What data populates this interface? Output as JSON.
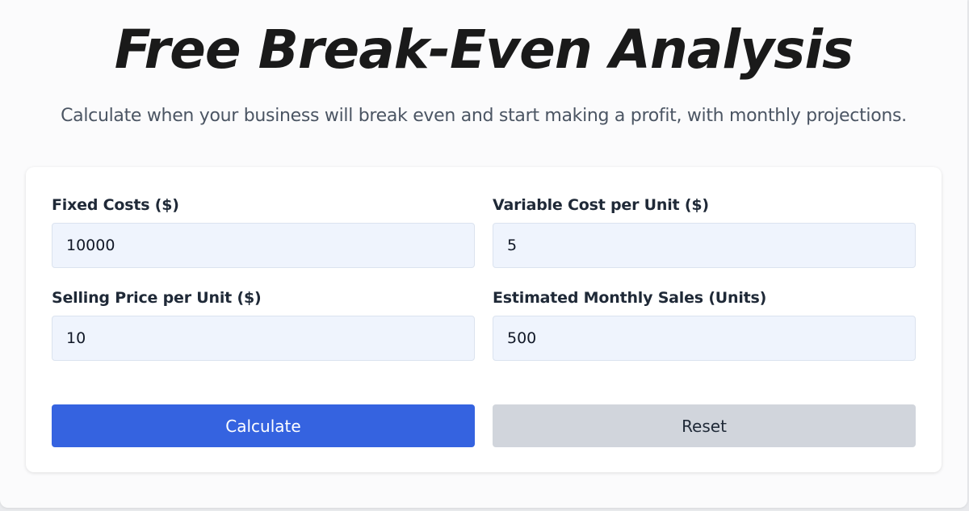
{
  "header": {
    "title": "Free Break-Even Analysis",
    "subtitle": "Calculate when your business will break even and start making a profit, with monthly projections."
  },
  "form": {
    "fixed_costs": {
      "label": "Fixed Costs ($)",
      "value": "10000"
    },
    "variable_cost": {
      "label": "Variable Cost per Unit ($)",
      "value": "5"
    },
    "selling_price": {
      "label": "Selling Price per Unit ($)",
      "value": "10"
    },
    "monthly_sales": {
      "label": "Estimated Monthly Sales (Units)",
      "value": "500"
    }
  },
  "actions": {
    "calculate_label": "Calculate",
    "reset_label": "Reset"
  },
  "colors": {
    "primary": "#3563e0",
    "secondary": "#d1d5dc",
    "input_bg": "#eff4fd"
  }
}
